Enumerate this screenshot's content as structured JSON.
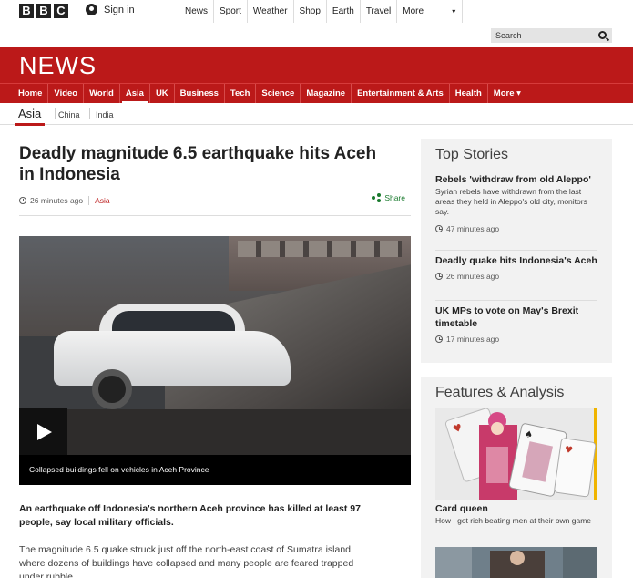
{
  "masthead": {
    "blocks": [
      "B",
      "B",
      "C"
    ],
    "signin_label": "Sign in",
    "nav": [
      "News",
      "Sport",
      "Weather",
      "Shop",
      "Earth",
      "Travel",
      "More"
    ],
    "search_placeholder": "Search",
    "logo": "NEWS"
  },
  "main_nav": [
    "Home",
    "Video",
    "World",
    "Asia",
    "UK",
    "Business",
    "Tech",
    "Science",
    "Magazine",
    "Entertainment & Arts",
    "Health",
    "More"
  ],
  "sub_nav": {
    "current": "Asia",
    "items": [
      "China",
      "India"
    ]
  },
  "article": {
    "headline": "Deadly magnitude 6.5 earthquake hits Aceh in Indonesia",
    "time": "26 minutes ago",
    "topic": "Asia",
    "share_label": "Share",
    "caption": "Collapsed buildings fell on vehicles in Aceh Province",
    "lead": "An earthquake off Indonesia's northern Aceh province has killed at least 97 people, say local military officials.",
    "paragraph": "The magnitude 6.5 quake struck just off the north-east coast of Sumatra island, where dozens of buildings have collapsed and many people are feared trapped under rubble."
  },
  "top_stories": {
    "heading": "Top Stories",
    "items": [
      {
        "title": "Rebels 'withdraw from old Aleppo'",
        "summary": "Syrian rebels have withdrawn from the last areas they held in Aleppo's old city, monitors say.",
        "time": "47 minutes ago"
      },
      {
        "title": "Deadly quake hits Indonesia's Aceh",
        "summary": "",
        "time": "26 minutes ago"
      },
      {
        "title": "UK MPs to vote on May's Brexit timetable",
        "summary": "",
        "time": "17 minutes ago"
      }
    ]
  },
  "features": {
    "heading": "Features & Analysis",
    "items": [
      {
        "title": "Card queen",
        "summary": "How I got rich beating men at their own game"
      }
    ]
  },
  "colors": {
    "brand_red": "#bb1919",
    "share_green": "#1a7a2e",
    "panel_bg": "#f2f2f2"
  }
}
